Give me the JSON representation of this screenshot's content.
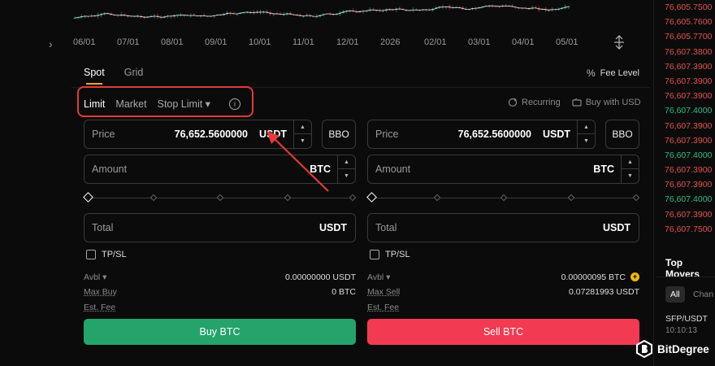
{
  "chart": {
    "x_ticks": [
      "06/01",
      "07/01",
      "08/01",
      "09/01",
      "10/01",
      "11/01",
      "12/01",
      "2026",
      "02/01",
      "03/01",
      "04/01",
      "05/01"
    ],
    "nav_left": "›"
  },
  "orderbook": {
    "prices": [
      "76,605.7500",
      "76,605.7600",
      "76,605.7700",
      "76,607.3800",
      "76,607.3900",
      "76,607.3900",
      "76,607.3900",
      "76,607.4000",
      "76,607.3900",
      "76,607.3900",
      "76,607.4000",
      "76,607.3900",
      "76,607.3900",
      "76,607.4000",
      "76,607.3900",
      "76,607.7500",
      "76,607.4000"
    ],
    "colors": [
      "red",
      "red",
      "red",
      "red",
      "red",
      "red",
      "red",
      "green",
      "red",
      "red",
      "green",
      "red",
      "red",
      "green",
      "red",
      "red",
      "red"
    ]
  },
  "tabs": [
    {
      "label": "Spot",
      "active": true
    },
    {
      "label": "Grid",
      "active": false
    }
  ],
  "fee_level": {
    "label": "Fee Level",
    "icon": "percent-icon"
  },
  "order_types": {
    "limit": "Limit",
    "market": "Market",
    "stop_limit": "Stop Limit ▾",
    "info": "i"
  },
  "options": {
    "recurring": "Recurring",
    "buy_with_usd": "Buy with USD"
  },
  "buy": {
    "price_label": "Price",
    "price_value": "76,652.5600000",
    "price_unit": "USDT",
    "bbo": "BBO",
    "amount_label": "Amount",
    "amount_unit": "BTC",
    "total_label": "Total",
    "total_unit": "USDT",
    "tpsl": "TP/SL",
    "avbl_label": "Avbl ▾",
    "avbl_value": "0.00000000 USDT",
    "max_label": "Max Buy",
    "max_value": "0 BTC",
    "fee_label": "Est. Fee",
    "button": "Buy BTC",
    "slider_fraction": 0
  },
  "sell": {
    "price_label": "Price",
    "price_value": "76,652.5600000",
    "price_unit": "USDT",
    "bbo": "BBO",
    "amount_label": "Amount",
    "amount_unit": "BTC",
    "total_label": "Total",
    "total_unit": "USDT",
    "tpsl": "TP/SL",
    "avbl_label": "Avbl ▾",
    "avbl_value": "0.00000095 BTC",
    "max_label": "Max Sell",
    "max_value": "0.07281993 USDT",
    "fee_label": "Est. Fee",
    "button": "Sell BTC",
    "slider_fraction": 0
  },
  "top_movers": {
    "title": "Top Movers",
    "chip_all": "All",
    "chip_change": "Chan",
    "pair": "SFP/USDT",
    "time": "10:10:13"
  },
  "watermark": {
    "text": "BitDegree"
  },
  "colors": {
    "buy": "#24a46b",
    "sell": "#f23b52",
    "ask": "#e0534e",
    "bid": "#2dbd85",
    "annotation": "#e23a3a"
  }
}
